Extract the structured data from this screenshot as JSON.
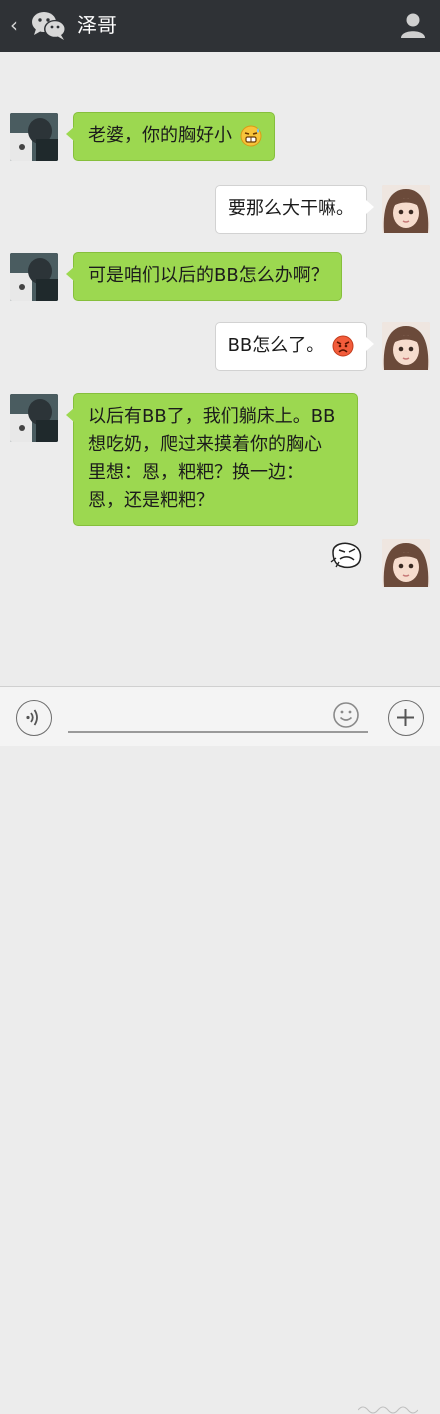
{
  "header": {
    "back_icon": "chevron-left-icon",
    "app_icon": "wechat-icon",
    "title": "泽哥",
    "profile_icon": "person-icon"
  },
  "messages": [
    {
      "side": "left",
      "text": "老婆，你的胸好小",
      "emoji": "sweat-grimace-emoji"
    },
    {
      "side": "right",
      "text": "要那么大干嘛。"
    },
    {
      "side": "left",
      "text": "可是咱们以后的BB怎么办啊？"
    },
    {
      "side": "right",
      "text": "BB怎么了。",
      "emoji": "angry-emoji"
    },
    {
      "side": "left",
      "lines": [
        "以后有BB了，我们躺床上。BB",
        "想吃奶，爬过来摸着你的胸心",
        "里想：恩，粑粑？换一边：",
        "恩，还是粑粑？"
      ]
    },
    {
      "side": "right",
      "sticker": "rage-comic-sticker"
    }
  ],
  "input_bar": {
    "voice_icon": "voice-icon",
    "emoji_icon": "smiley-icon",
    "plus_icon": "plus-icon"
  },
  "colors": {
    "header_bg": "#2f3236",
    "chat_bg": "#ececec",
    "sent_bubble": "#9cd850",
    "received_bubble": "#ffffff"
  }
}
